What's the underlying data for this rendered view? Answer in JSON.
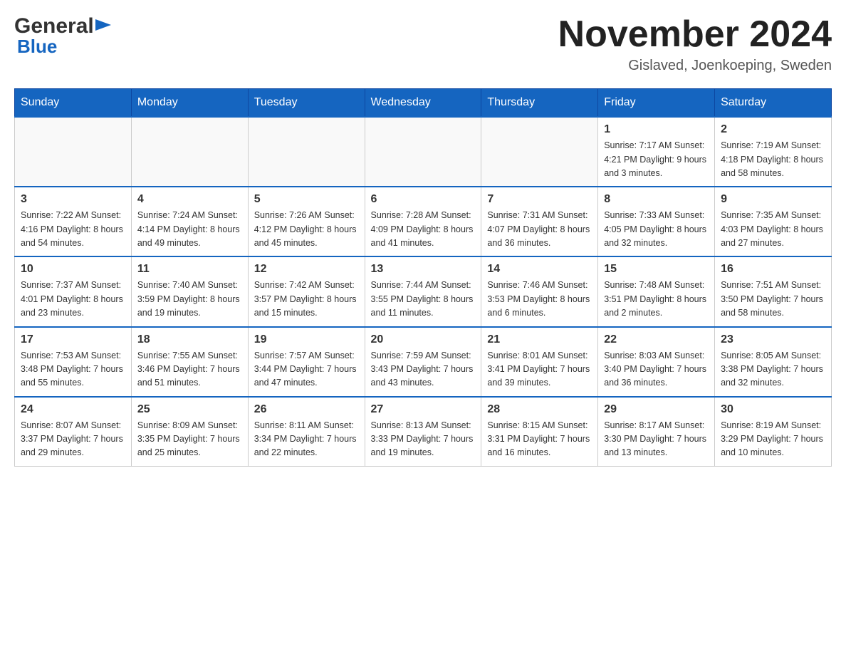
{
  "header": {
    "logo_general": "General",
    "logo_blue": "Blue",
    "month_title": "November 2024",
    "location": "Gislaved, Joenkoeping, Sweden"
  },
  "days_of_week": [
    "Sunday",
    "Monday",
    "Tuesday",
    "Wednesday",
    "Thursday",
    "Friday",
    "Saturday"
  ],
  "weeks": [
    {
      "days": [
        {
          "number": "",
          "info": ""
        },
        {
          "number": "",
          "info": ""
        },
        {
          "number": "",
          "info": ""
        },
        {
          "number": "",
          "info": ""
        },
        {
          "number": "",
          "info": ""
        },
        {
          "number": "1",
          "info": "Sunrise: 7:17 AM\nSunset: 4:21 PM\nDaylight: 9 hours\nand 3 minutes."
        },
        {
          "number": "2",
          "info": "Sunrise: 7:19 AM\nSunset: 4:18 PM\nDaylight: 8 hours\nand 58 minutes."
        }
      ]
    },
    {
      "days": [
        {
          "number": "3",
          "info": "Sunrise: 7:22 AM\nSunset: 4:16 PM\nDaylight: 8 hours\nand 54 minutes."
        },
        {
          "number": "4",
          "info": "Sunrise: 7:24 AM\nSunset: 4:14 PM\nDaylight: 8 hours\nand 49 minutes."
        },
        {
          "number": "5",
          "info": "Sunrise: 7:26 AM\nSunset: 4:12 PM\nDaylight: 8 hours\nand 45 minutes."
        },
        {
          "number": "6",
          "info": "Sunrise: 7:28 AM\nSunset: 4:09 PM\nDaylight: 8 hours\nand 41 minutes."
        },
        {
          "number": "7",
          "info": "Sunrise: 7:31 AM\nSunset: 4:07 PM\nDaylight: 8 hours\nand 36 minutes."
        },
        {
          "number": "8",
          "info": "Sunrise: 7:33 AM\nSunset: 4:05 PM\nDaylight: 8 hours\nand 32 minutes."
        },
        {
          "number": "9",
          "info": "Sunrise: 7:35 AM\nSunset: 4:03 PM\nDaylight: 8 hours\nand 27 minutes."
        }
      ]
    },
    {
      "days": [
        {
          "number": "10",
          "info": "Sunrise: 7:37 AM\nSunset: 4:01 PM\nDaylight: 8 hours\nand 23 minutes."
        },
        {
          "number": "11",
          "info": "Sunrise: 7:40 AM\nSunset: 3:59 PM\nDaylight: 8 hours\nand 19 minutes."
        },
        {
          "number": "12",
          "info": "Sunrise: 7:42 AM\nSunset: 3:57 PM\nDaylight: 8 hours\nand 15 minutes."
        },
        {
          "number": "13",
          "info": "Sunrise: 7:44 AM\nSunset: 3:55 PM\nDaylight: 8 hours\nand 11 minutes."
        },
        {
          "number": "14",
          "info": "Sunrise: 7:46 AM\nSunset: 3:53 PM\nDaylight: 8 hours\nand 6 minutes."
        },
        {
          "number": "15",
          "info": "Sunrise: 7:48 AM\nSunset: 3:51 PM\nDaylight: 8 hours\nand 2 minutes."
        },
        {
          "number": "16",
          "info": "Sunrise: 7:51 AM\nSunset: 3:50 PM\nDaylight: 7 hours\nand 58 minutes."
        }
      ]
    },
    {
      "days": [
        {
          "number": "17",
          "info": "Sunrise: 7:53 AM\nSunset: 3:48 PM\nDaylight: 7 hours\nand 55 minutes."
        },
        {
          "number": "18",
          "info": "Sunrise: 7:55 AM\nSunset: 3:46 PM\nDaylight: 7 hours\nand 51 minutes."
        },
        {
          "number": "19",
          "info": "Sunrise: 7:57 AM\nSunset: 3:44 PM\nDaylight: 7 hours\nand 47 minutes."
        },
        {
          "number": "20",
          "info": "Sunrise: 7:59 AM\nSunset: 3:43 PM\nDaylight: 7 hours\nand 43 minutes."
        },
        {
          "number": "21",
          "info": "Sunrise: 8:01 AM\nSunset: 3:41 PM\nDaylight: 7 hours\nand 39 minutes."
        },
        {
          "number": "22",
          "info": "Sunrise: 8:03 AM\nSunset: 3:40 PM\nDaylight: 7 hours\nand 36 minutes."
        },
        {
          "number": "23",
          "info": "Sunrise: 8:05 AM\nSunset: 3:38 PM\nDaylight: 7 hours\nand 32 minutes."
        }
      ]
    },
    {
      "days": [
        {
          "number": "24",
          "info": "Sunrise: 8:07 AM\nSunset: 3:37 PM\nDaylight: 7 hours\nand 29 minutes."
        },
        {
          "number": "25",
          "info": "Sunrise: 8:09 AM\nSunset: 3:35 PM\nDaylight: 7 hours\nand 25 minutes."
        },
        {
          "number": "26",
          "info": "Sunrise: 8:11 AM\nSunset: 3:34 PM\nDaylight: 7 hours\nand 22 minutes."
        },
        {
          "number": "27",
          "info": "Sunrise: 8:13 AM\nSunset: 3:33 PM\nDaylight: 7 hours\nand 19 minutes."
        },
        {
          "number": "28",
          "info": "Sunrise: 8:15 AM\nSunset: 3:31 PM\nDaylight: 7 hours\nand 16 minutes."
        },
        {
          "number": "29",
          "info": "Sunrise: 8:17 AM\nSunset: 3:30 PM\nDaylight: 7 hours\nand 13 minutes."
        },
        {
          "number": "30",
          "info": "Sunrise: 8:19 AM\nSunset: 3:29 PM\nDaylight: 7 hours\nand 10 minutes."
        }
      ]
    }
  ]
}
